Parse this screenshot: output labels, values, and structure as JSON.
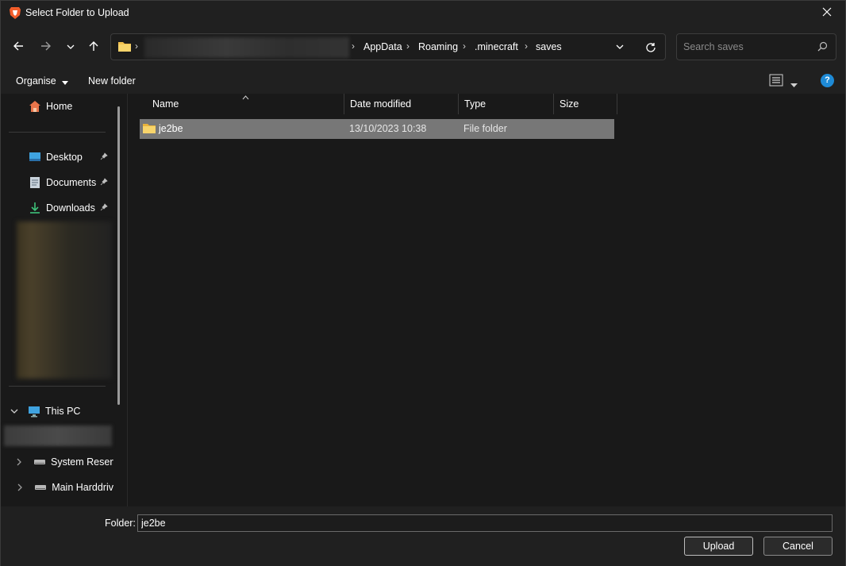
{
  "window": {
    "title": "Select Folder to Upload",
    "app_icon": "brave-lion-icon",
    "close_icon": "close-icon"
  },
  "nav": {
    "back_icon": "arrow-left-icon",
    "forward_icon": "arrow-right-icon",
    "recent_icon": "chevron-down-icon",
    "up_icon": "arrow-up-icon"
  },
  "address": {
    "breadcrumbs": [
      "AppData",
      "Roaming",
      ".minecraft",
      "saves"
    ],
    "separator": "›"
  },
  "search": {
    "placeholder": "Search saves"
  },
  "commandbar": {
    "organise_label": "Organise",
    "new_folder_label": "New folder",
    "help_label": "?"
  },
  "sidebar": {
    "home": "Home",
    "quick_access": [
      {
        "label": "Desktop",
        "icon": "desktop-icon"
      },
      {
        "label": "Documents",
        "icon": "documents-icon"
      },
      {
        "label": "Downloads",
        "icon": "downloads-icon"
      }
    ],
    "this_pc": "This PC",
    "drives": [
      "System Reserv",
      "Main Harddriv"
    ]
  },
  "filelist": {
    "columns": [
      "Name",
      "Date modified",
      "Type",
      "Size"
    ],
    "rows": [
      {
        "name": "je2be",
        "date": "13/10/2023 10:38",
        "type": "File folder",
        "size": ""
      }
    ]
  },
  "footer": {
    "folder_label": "Folder:",
    "folder_value": "je2be",
    "upload_label": "Upload",
    "cancel_label": "Cancel"
  },
  "colors": {
    "background": "#191919",
    "chrome": "#202020",
    "selection": "#777777",
    "accent": "#1e8ad6",
    "folder_yellow": "#f2c14e"
  }
}
